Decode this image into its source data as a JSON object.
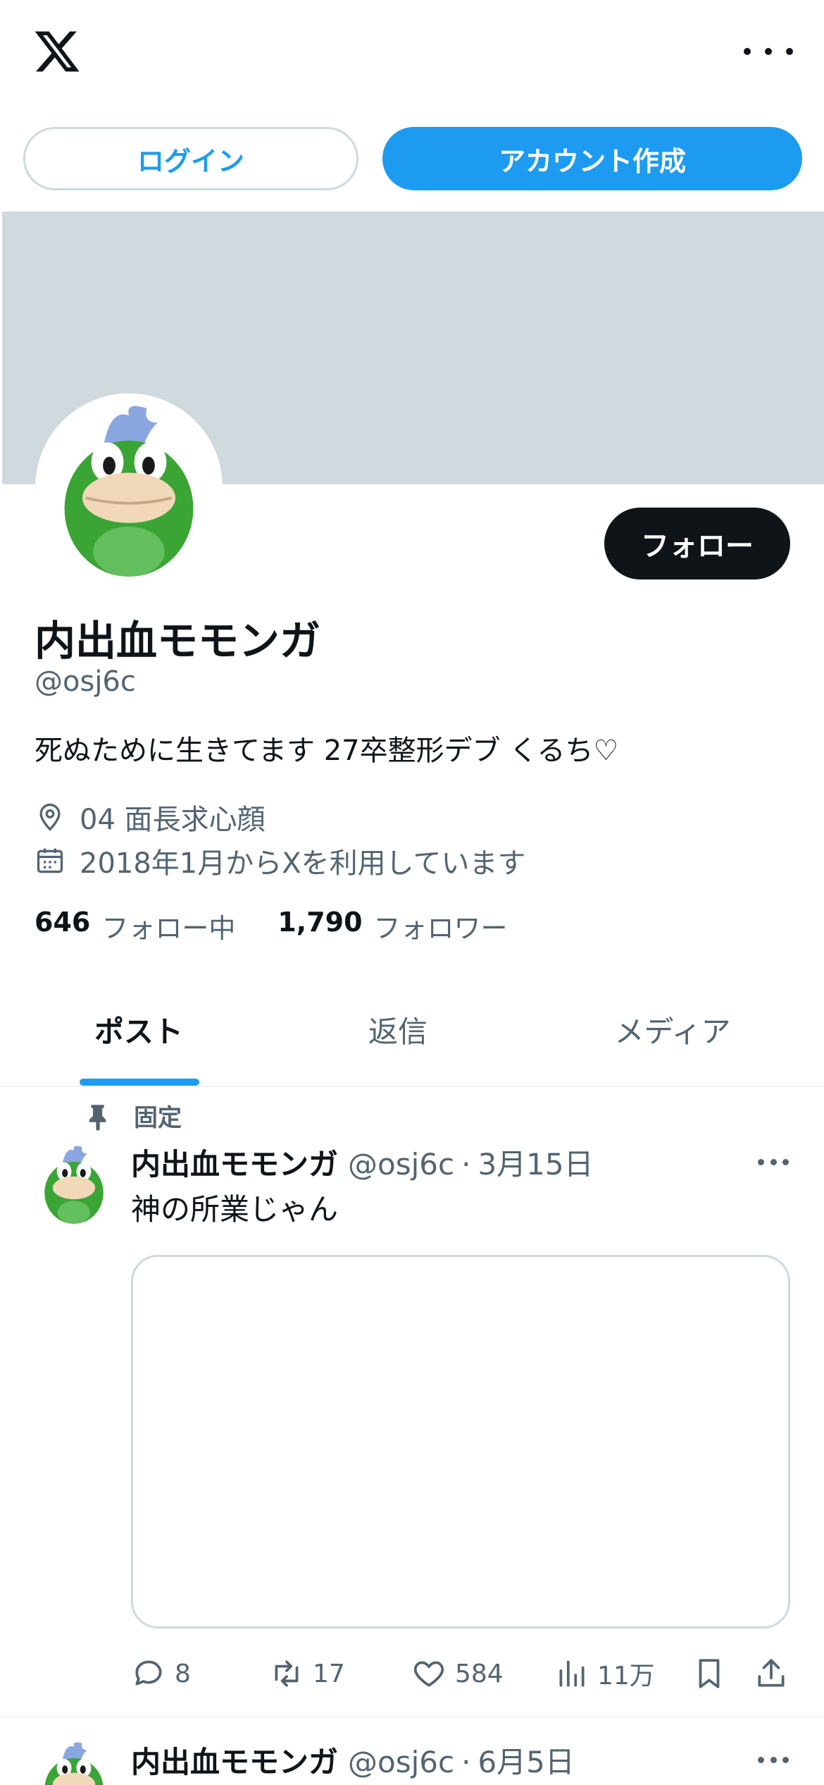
{
  "topbar": {
    "logo_icon": "x-logo-icon",
    "more_icon": "more-horizontal-icon"
  },
  "auth": {
    "login_label": "ログイン",
    "signup_label": "アカウント作成"
  },
  "profile": {
    "follow_label": "フォロー",
    "display_name": "内出血モモンガ",
    "handle": "@osj6c",
    "bio": "死ぬために生きてます 27卒整形デブ くるち♡",
    "location": "04 面長求心顔",
    "joined": "2018年1月からXを利用しています",
    "following_count": "646",
    "following_label": "フォロー中",
    "followers_count": "1,790",
    "followers_label": "フォロワー"
  },
  "tabs": [
    {
      "label": "ポスト",
      "active": true
    },
    {
      "label": "返信",
      "active": false
    },
    {
      "label": "メディア",
      "active": false
    }
  ],
  "posts": [
    {
      "pinned_label": "固定",
      "name": "内出血モモンガ",
      "handle": "@osj6c",
      "separator": "·",
      "date": "3月15日",
      "text": "神の所業じゃん",
      "replies": "8",
      "reposts": "17",
      "likes": "584",
      "views": "11万"
    },
    {
      "name": "内出血モモンガ",
      "handle": "@osj6c",
      "separator": "·",
      "date": "6月5日"
    }
  ],
  "colors": {
    "accent": "#1d9bf0",
    "text_primary": "#0f1419",
    "text_secondary": "#536471",
    "banner": "#cfd9de",
    "border": "#cfd9de"
  }
}
